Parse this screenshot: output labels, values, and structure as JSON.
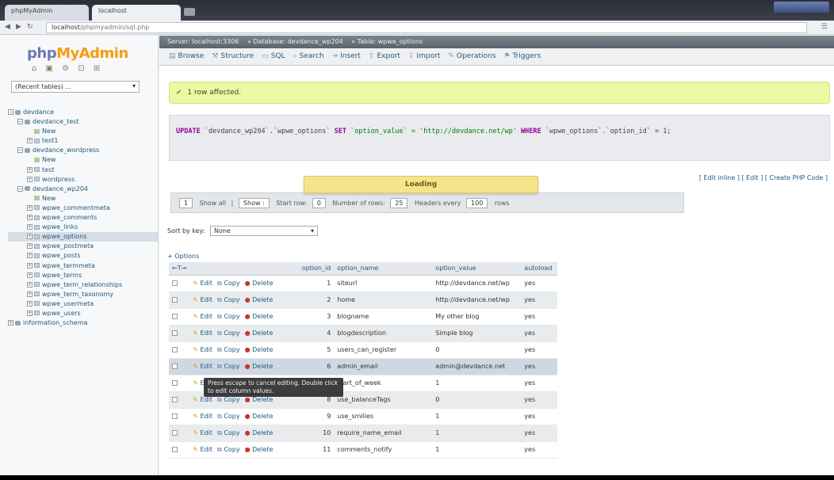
{
  "browser": {
    "tabs": [
      {
        "label": "phpMyAdmin"
      },
      {
        "label": "localhost"
      }
    ],
    "url_host": "localhost",
    "url": "/phpmyadmin/sql.php"
  },
  "sidebar": {
    "logo_a": "php",
    "logo_b": "MyAdmin",
    "quick_icons": "⌂ ▣ ⚙ ⊡ ⊞",
    "recent": "(Recent tables) ...",
    "tree": [
      {
        "label": "devdance",
        "kind": "db",
        "indent": 0,
        "toggle": "−"
      },
      {
        "label": "devdance_test",
        "kind": "db",
        "indent": 1,
        "toggle": "−"
      },
      {
        "label": "New",
        "kind": "new",
        "indent": 2,
        "toggle": ""
      },
      {
        "label": "test1",
        "kind": "tb",
        "indent": 2,
        "toggle": "+"
      },
      {
        "label": "devdance_wordpress",
        "kind": "db",
        "indent": 1,
        "toggle": "−"
      },
      {
        "label": "New",
        "kind": "new",
        "indent": 2,
        "toggle": ""
      },
      {
        "label": "test",
        "kind": "tb",
        "indent": 2,
        "toggle": "+"
      },
      {
        "label": "wordpress",
        "kind": "tb",
        "indent": 2,
        "toggle": "+"
      },
      {
        "label": "devdance_wp204",
        "kind": "db",
        "indent": 1,
        "toggle": "−"
      },
      {
        "label": "New",
        "kind": "new",
        "indent": 2,
        "toggle": ""
      },
      {
        "label": "wpwe_commentmeta",
        "kind": "tb",
        "indent": 2,
        "toggle": "+"
      },
      {
        "label": "wpwe_comments",
        "kind": "tb",
        "indent": 2,
        "toggle": "+"
      },
      {
        "label": "wpwe_links",
        "kind": "tb",
        "indent": 2,
        "toggle": "+"
      },
      {
        "label": "wpwe_options",
        "kind": "tb",
        "indent": 2,
        "toggle": "+",
        "selected": true
      },
      {
        "label": "wpwe_postmeta",
        "kind": "tb",
        "indent": 2,
        "toggle": "+"
      },
      {
        "label": "wpwe_posts",
        "kind": "tb",
        "indent": 2,
        "toggle": "+"
      },
      {
        "label": "wpwe_termmeta",
        "kind": "tb",
        "indent": 2,
        "toggle": "+"
      },
      {
        "label": "wpwe_terms",
        "kind": "tb",
        "indent": 2,
        "toggle": "+"
      },
      {
        "label": "wpwe_term_relationships",
        "kind": "tb",
        "indent": 2,
        "toggle": "+"
      },
      {
        "label": "wpwe_term_taxonomy",
        "kind": "tb",
        "indent": 2,
        "toggle": "+"
      },
      {
        "label": "wpwe_usermeta",
        "kind": "tb",
        "indent": 2,
        "toggle": "+"
      },
      {
        "label": "wpwe_users",
        "kind": "tb",
        "indent": 2,
        "toggle": "+"
      },
      {
        "label": "information_schema",
        "kind": "db",
        "indent": 0,
        "toggle": "+"
      }
    ]
  },
  "breadcrumb": [
    "Server: localhost:3306",
    "» Database: devdance_wp204",
    "» Table: wpwe_options"
  ],
  "tabs": [
    {
      "icon": "▤",
      "label": "Browse"
    },
    {
      "icon": "⚒",
      "label": "Structure"
    },
    {
      "icon": "▭",
      "label": "SQL"
    },
    {
      "icon": "⌕",
      "label": "Search"
    },
    {
      "icon": "⇥",
      "label": "Insert"
    },
    {
      "icon": "⇪",
      "label": "Export"
    },
    {
      "icon": "⇩",
      "label": "Import"
    },
    {
      "icon": "✎",
      "label": "Operations"
    },
    {
      "icon": "⚑",
      "label": "Triggers"
    }
  ],
  "success_msg": "1 row affected.",
  "sql": {
    "kw_update": "UPDATE",
    "table": "`devdance_wp204`.`wpwe_options`",
    "kw_set": "SET",
    "assign": "`option_value` = 'http://devdance.net/wp'",
    "kw_where": "WHERE",
    "cond": "`wpwe_options`.`option_id`",
    "cond2": "= 1;"
  },
  "inline_links": "[ Edit inline ] [ Edit ] [ Create PHP Code ]",
  "loading": "Loading",
  "navbar": {
    "first": "1",
    "show_all": "Show all",
    "pipe": "|",
    "show_label": "Show :",
    "start_row": "Start row:",
    "start_row_val": "0",
    "num_rows_label": "Number of rows:",
    "num_rows_val": "25",
    "headers_label": "Headers every",
    "headers_val": "100",
    "rows_label": "rows"
  },
  "sort": {
    "label": "Sort by key:",
    "value": "None"
  },
  "options_link": "+ Options",
  "table": {
    "columns": [
      "",
      "",
      "option_id",
      "option_name",
      "option_value",
      "autoload"
    ],
    "action_edit": "Edit",
    "action_copy": "Copy",
    "action_delete": "Delete",
    "rows": [
      {
        "id": "1",
        "name": "siteurl",
        "value": "http://devdance.net/wp",
        "autoload": "yes"
      },
      {
        "id": "2",
        "name": "home",
        "value": "http://devdance.net/wp",
        "autoload": "yes"
      },
      {
        "id": "3",
        "name": "blogname",
        "value": "My other blog",
        "autoload": "yes"
      },
      {
        "id": "4",
        "name": "blogdescription",
        "value": "Simple blog",
        "autoload": "yes"
      },
      {
        "id": "5",
        "name": "users_can_register",
        "value": "0",
        "autoload": "yes"
      },
      {
        "id": "6",
        "name": "admin_email",
        "value": "admin@devdance.net",
        "autoload": "yes"
      },
      {
        "id": "7",
        "name": "start_of_week",
        "value": "1",
        "autoload": "yes"
      },
      {
        "id": "8",
        "name": "use_balanceTags",
        "value": "0",
        "autoload": "yes"
      },
      {
        "id": "9",
        "name": "use_smilies",
        "value": "1",
        "autoload": "yes"
      },
      {
        "id": "10",
        "name": "require_name_email",
        "value": "1",
        "autoload": "yes"
      },
      {
        "id": "11",
        "name": "comments_notify",
        "value": "1",
        "autoload": "yes"
      }
    ]
  },
  "tooltip": "Press escape to cancel editing. Double click to edit column values."
}
